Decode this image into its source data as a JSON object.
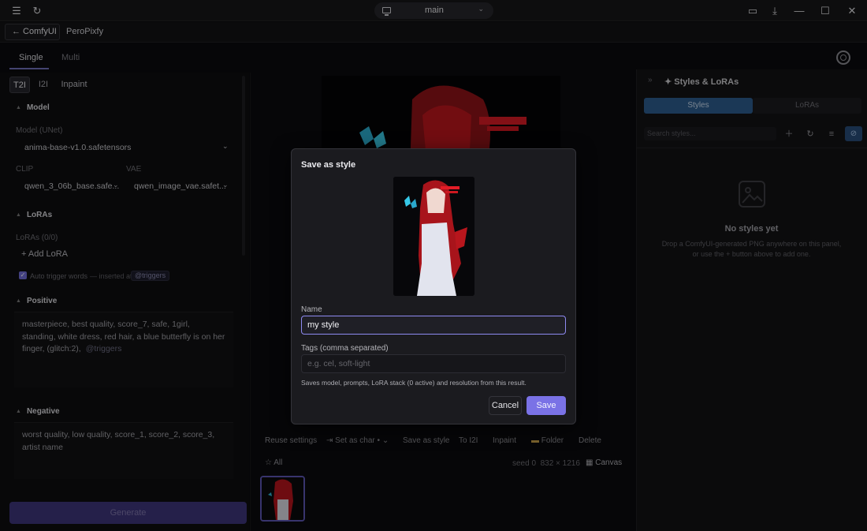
{
  "window": {
    "tab_label": "main"
  },
  "nav": {
    "back_label": "← ComfyUI",
    "app_name": "PeroPixfy"
  },
  "modes": {
    "single": "Single",
    "multi": "Multi"
  },
  "left": {
    "subtabs": [
      "T2I",
      "I2I",
      "Inpaint"
    ],
    "model_section": "Model",
    "model_label": "Model (UNet)",
    "model_value": "anima-base-v1.0.safetensors",
    "clip_label": "CLIP",
    "clip_value": "qwen_3_06b_base.safe...",
    "vae_label": "VAE",
    "vae_value": "qwen_image_vae.safet...",
    "loras_section": "LoRAs",
    "loras_count": "LoRAs (0/0)",
    "add_lora": "+ Add LoRA",
    "auto_trigger": "Auto trigger words",
    "auto_inserted": "— inserted at",
    "trigger_chip": "@triggers",
    "positive_section": "Positive",
    "positive_text": "masterpiece, best quality, score_7, safe, 1girl, standing, white dress, red hair, a blue butterfly is on her finger, (glitch:2),",
    "positive_trigger": "@triggers",
    "negative_section": "Negative",
    "negative_text": "worst quality, low quality, score_1, score_2, score_3, artist name",
    "generate": "Generate"
  },
  "center": {
    "toolbar": [
      "Reuse settings",
      "Set as char",
      "Save as style",
      "To I2I",
      "Inpaint",
      "Folder",
      "Delete"
    ],
    "all": "All",
    "seed": "seed 0",
    "dimensions": "832 × 1216",
    "canvas": "Canvas"
  },
  "right": {
    "title": "Styles & LoRAs",
    "tab_styles": "Styles",
    "tab_loras": "LoRAs",
    "search_placeholder": "Search styles...",
    "empty_title": "No styles yet",
    "empty_desc_1": "Drop a ComfyUI-generated PNG anywhere on this panel,",
    "empty_desc_2": "or use the + button above to add one."
  },
  "modal": {
    "title": "Save as style",
    "name_label": "Name",
    "name_value": "my style",
    "tags_label": "Tags (comma separated)",
    "tags_placeholder": "e.g. cel, soft-light",
    "hint": "Saves model, prompts, LoRA stack (0 active) and resolution from this result.",
    "cancel": "Cancel",
    "save": "Save"
  },
  "colors": {
    "accent": "#7a72e6",
    "styles_tab": "#2c5b8c",
    "generate_bg": "#3c3478"
  }
}
